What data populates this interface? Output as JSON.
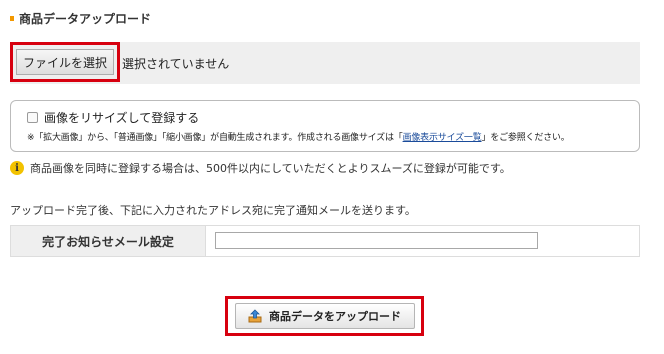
{
  "section": {
    "title": "商品データアップロード"
  },
  "file_select": {
    "button_label": "ファイルを選択",
    "status": "選択されていません"
  },
  "resize": {
    "checkbox_label": "画像をリサイズして登録する",
    "note_before": "※「拡大画像」から、「普通画像」「縮小画像」が自動生成されます。作成される画像サイズは「",
    "note_link": "画像表示サイズ一覧",
    "note_after": "」をご参照ください。",
    "checked": false
  },
  "info": {
    "icon": "info-icon",
    "text": "商品画像を同時に登録する場合は、500件以内にしていただくとよりスムーズに登録が可能です。"
  },
  "notice": "アップロード完了後、下記に入力されたアドレス宛に完了通知メールを送ります。",
  "mail_setting": {
    "label": "完了お知らせメール設定",
    "value": ""
  },
  "upload": {
    "button_label": "商品データをアップロード",
    "icon": "upload-icon"
  },
  "colors": {
    "highlight": "#d7000f",
    "marker": "#f39800",
    "info": "#f2c200",
    "link": "#1a4b9a"
  }
}
